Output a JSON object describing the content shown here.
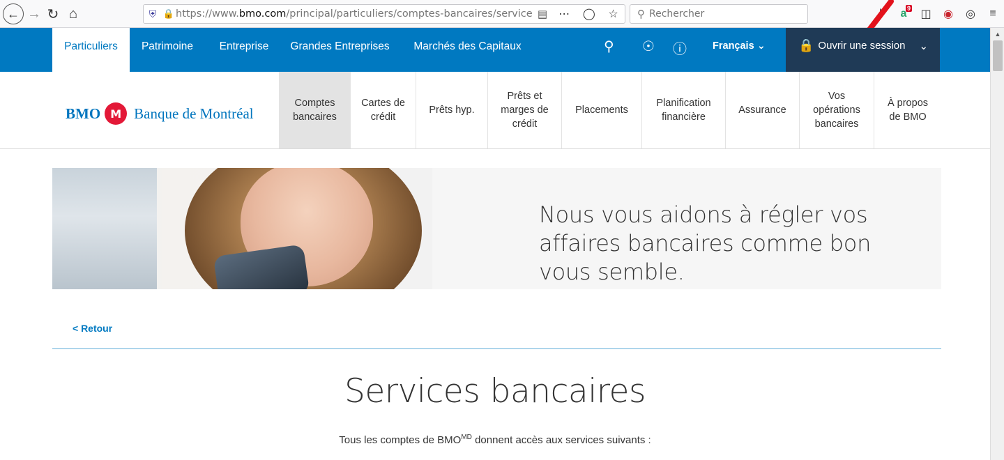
{
  "browser": {
    "back_icon": "back-icon",
    "url_host": "https://www.",
    "url_domain": "bmo.com",
    "url_path": "/principal/particuliers/comptes-bancaires/services-ba",
    "search_placeholder": "Rechercher",
    "extension_badge": "9"
  },
  "topnav": {
    "tabs": [
      {
        "label": "Particuliers"
      },
      {
        "label": "Patrimoine"
      },
      {
        "label": "Entreprise"
      },
      {
        "label": "Grandes Entreprises"
      },
      {
        "label": "Marchés des Capitaux"
      }
    ],
    "language": "Français",
    "session_label": "Ouvrir une session"
  },
  "logo": {
    "short": "BMO",
    "name": "Banque de Montréal"
  },
  "mainnav": {
    "items": [
      {
        "label": "Comptes bancaires"
      },
      {
        "label": "Cartes de crédit"
      },
      {
        "label": "Prêts hyp."
      },
      {
        "label": "Prêts et marges de crédit"
      },
      {
        "label": "Placements"
      },
      {
        "label": "Planification financière"
      },
      {
        "label": "Assurance"
      },
      {
        "label": "Vos opérations bancaires"
      },
      {
        "label": "À propos de BMO"
      }
    ]
  },
  "hero": {
    "text": "Nous vous aidons à régler vos affaires bancaires comme bon vous semble."
  },
  "back_link": "< Retour",
  "page": {
    "title": "Services bancaires",
    "subtitle_pre": "Tous les comptes de BMO",
    "subtitle_sup": "MD",
    "subtitle_post": " donnent accès aux services suivants :"
  },
  "colors": {
    "brand_blue": "#0079c1",
    "session_bg": "#1f3a56",
    "brand_red": "#e31837"
  }
}
